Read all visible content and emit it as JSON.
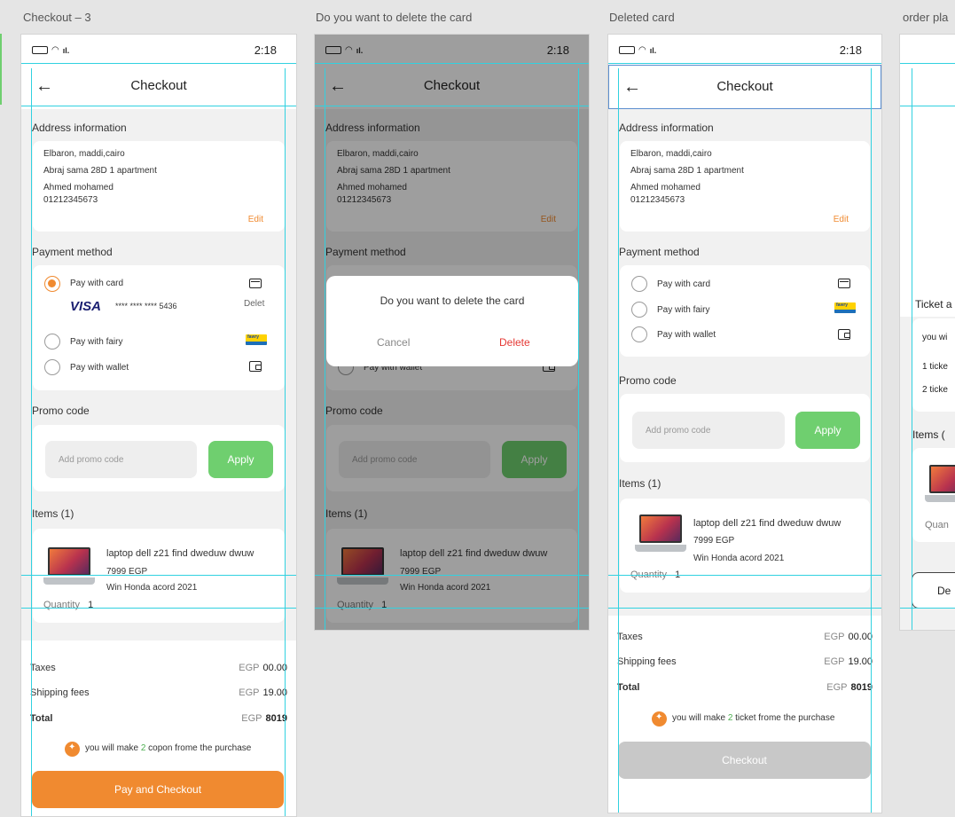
{
  "frames": {
    "checkout": {
      "title": "Checkout – 3"
    },
    "dialog": {
      "title": "Do you want to delete the card"
    },
    "deleted": {
      "title": "Deleted card"
    },
    "placed": {
      "title": "order pla"
    }
  },
  "status_time": "2:18",
  "header_title": "Checkout",
  "address": {
    "label": "Address information",
    "line1": "Elbaron, maddi,cairo",
    "line2": "Abraj sama 28D 1 apartment",
    "name": "Ahmed mohamed",
    "phone": "01212345673",
    "edit": "Edit"
  },
  "payment": {
    "label": "Payment method",
    "card": "Pay with card",
    "fawry": "Pay with fairy",
    "wallet": "Pay with wallet",
    "visa": "VISA",
    "masked": "**** **** **** 5436",
    "delete": "Delet",
    "fawry_logo": "fawry"
  },
  "promo": {
    "label": "Promo code",
    "placeholder": "Add promo code",
    "apply": "Apply"
  },
  "items": {
    "label": "Items  (1)",
    "name": "laptop dell z21 find dweduw dwuw",
    "price": "7999 EGP",
    "sub": "Win Honda acord 2021",
    "qty_label": "Quantity",
    "qty": "1"
  },
  "summary": {
    "taxes": "Taxes",
    "shipping": "Shipping fees",
    "total": "Total",
    "currency": "EGP",
    "taxes_amt": "00.00",
    "shipping_amt": "19.00",
    "total_amt": "8019"
  },
  "note_coupon": {
    "pre": "you will make ",
    "n": "2",
    "post": " copon frome the purchase"
  },
  "note_ticket": {
    "pre": "you will make ",
    "n": "2",
    "post": " ticket frome the purchase"
  },
  "pay_button": "Pay and Checkout",
  "checkout_button": "Checkout",
  "dialog": {
    "message": "Do you want to delete the card",
    "cancel": "Cancel",
    "delete": "Delete"
  },
  "partial": {
    "ticket": "Ticket a",
    "you": "you wi",
    "t1": "1  ticke",
    "t2": "2  ticke",
    "items": "Items  (",
    "quan": "Quan",
    "btn": "De"
  },
  "colors": {
    "accent": "#f08a30",
    "apply": "#6fcf6f",
    "guide": "#31d1e0",
    "delete": "#e53935"
  }
}
